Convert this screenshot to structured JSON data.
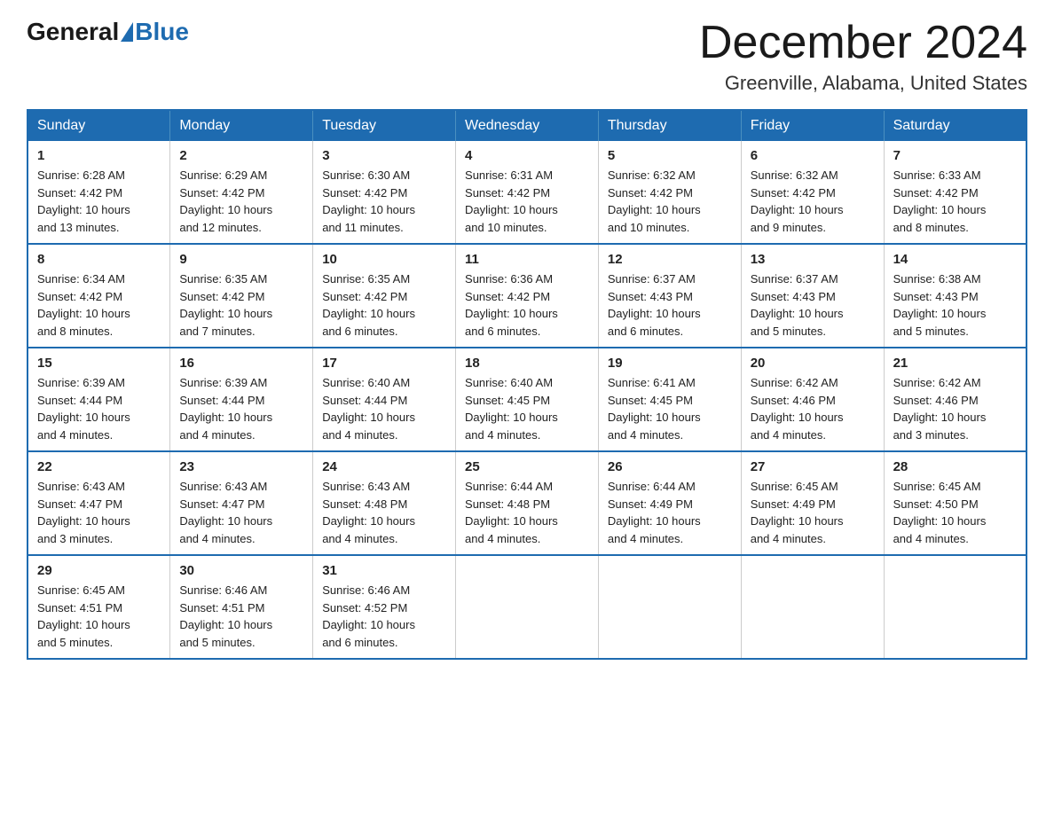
{
  "header": {
    "logo_text_general": "General",
    "logo_text_blue": "Blue",
    "month_title": "December 2024",
    "location": "Greenville, Alabama, United States"
  },
  "weekdays": [
    "Sunday",
    "Monday",
    "Tuesday",
    "Wednesday",
    "Thursday",
    "Friday",
    "Saturday"
  ],
  "weeks": [
    [
      {
        "day": "1",
        "sunrise": "6:28 AM",
        "sunset": "4:42 PM",
        "daylight": "10 hours and 13 minutes."
      },
      {
        "day": "2",
        "sunrise": "6:29 AM",
        "sunset": "4:42 PM",
        "daylight": "10 hours and 12 minutes."
      },
      {
        "day": "3",
        "sunrise": "6:30 AM",
        "sunset": "4:42 PM",
        "daylight": "10 hours and 11 minutes."
      },
      {
        "day": "4",
        "sunrise": "6:31 AM",
        "sunset": "4:42 PM",
        "daylight": "10 hours and 10 minutes."
      },
      {
        "day": "5",
        "sunrise": "6:32 AM",
        "sunset": "4:42 PM",
        "daylight": "10 hours and 10 minutes."
      },
      {
        "day": "6",
        "sunrise": "6:32 AM",
        "sunset": "4:42 PM",
        "daylight": "10 hours and 9 minutes."
      },
      {
        "day": "7",
        "sunrise": "6:33 AM",
        "sunset": "4:42 PM",
        "daylight": "10 hours and 8 minutes."
      }
    ],
    [
      {
        "day": "8",
        "sunrise": "6:34 AM",
        "sunset": "4:42 PM",
        "daylight": "10 hours and 8 minutes."
      },
      {
        "day": "9",
        "sunrise": "6:35 AM",
        "sunset": "4:42 PM",
        "daylight": "10 hours and 7 minutes."
      },
      {
        "day": "10",
        "sunrise": "6:35 AM",
        "sunset": "4:42 PM",
        "daylight": "10 hours and 6 minutes."
      },
      {
        "day": "11",
        "sunrise": "6:36 AM",
        "sunset": "4:42 PM",
        "daylight": "10 hours and 6 minutes."
      },
      {
        "day": "12",
        "sunrise": "6:37 AM",
        "sunset": "4:43 PM",
        "daylight": "10 hours and 6 minutes."
      },
      {
        "day": "13",
        "sunrise": "6:37 AM",
        "sunset": "4:43 PM",
        "daylight": "10 hours and 5 minutes."
      },
      {
        "day": "14",
        "sunrise": "6:38 AM",
        "sunset": "4:43 PM",
        "daylight": "10 hours and 5 minutes."
      }
    ],
    [
      {
        "day": "15",
        "sunrise": "6:39 AM",
        "sunset": "4:44 PM",
        "daylight": "10 hours and 4 minutes."
      },
      {
        "day": "16",
        "sunrise": "6:39 AM",
        "sunset": "4:44 PM",
        "daylight": "10 hours and 4 minutes."
      },
      {
        "day": "17",
        "sunrise": "6:40 AM",
        "sunset": "4:44 PM",
        "daylight": "10 hours and 4 minutes."
      },
      {
        "day": "18",
        "sunrise": "6:40 AM",
        "sunset": "4:45 PM",
        "daylight": "10 hours and 4 minutes."
      },
      {
        "day": "19",
        "sunrise": "6:41 AM",
        "sunset": "4:45 PM",
        "daylight": "10 hours and 4 minutes."
      },
      {
        "day": "20",
        "sunrise": "6:42 AM",
        "sunset": "4:46 PM",
        "daylight": "10 hours and 4 minutes."
      },
      {
        "day": "21",
        "sunrise": "6:42 AM",
        "sunset": "4:46 PM",
        "daylight": "10 hours and 3 minutes."
      }
    ],
    [
      {
        "day": "22",
        "sunrise": "6:43 AM",
        "sunset": "4:47 PM",
        "daylight": "10 hours and 3 minutes."
      },
      {
        "day": "23",
        "sunrise": "6:43 AM",
        "sunset": "4:47 PM",
        "daylight": "10 hours and 4 minutes."
      },
      {
        "day": "24",
        "sunrise": "6:43 AM",
        "sunset": "4:48 PM",
        "daylight": "10 hours and 4 minutes."
      },
      {
        "day": "25",
        "sunrise": "6:44 AM",
        "sunset": "4:48 PM",
        "daylight": "10 hours and 4 minutes."
      },
      {
        "day": "26",
        "sunrise": "6:44 AM",
        "sunset": "4:49 PM",
        "daylight": "10 hours and 4 minutes."
      },
      {
        "day": "27",
        "sunrise": "6:45 AM",
        "sunset": "4:49 PM",
        "daylight": "10 hours and 4 minutes."
      },
      {
        "day": "28",
        "sunrise": "6:45 AM",
        "sunset": "4:50 PM",
        "daylight": "10 hours and 4 minutes."
      }
    ],
    [
      {
        "day": "29",
        "sunrise": "6:45 AM",
        "sunset": "4:51 PM",
        "daylight": "10 hours and 5 minutes."
      },
      {
        "day": "30",
        "sunrise": "6:46 AM",
        "sunset": "4:51 PM",
        "daylight": "10 hours and 5 minutes."
      },
      {
        "day": "31",
        "sunrise": "6:46 AM",
        "sunset": "4:52 PM",
        "daylight": "10 hours and 6 minutes."
      },
      null,
      null,
      null,
      null
    ]
  ],
  "labels": {
    "sunrise": "Sunrise:",
    "sunset": "Sunset:",
    "daylight": "Daylight:"
  }
}
